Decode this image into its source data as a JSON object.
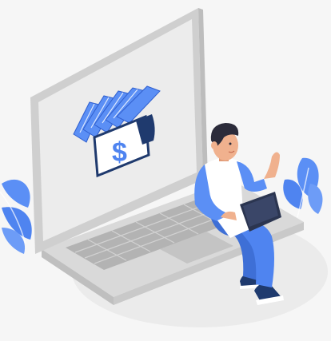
{
  "illustration": {
    "currency_symbol": "$",
    "colors": {
      "background": "#f6f6f6",
      "floor_shadow": "#ebebeb",
      "laptop_body": "#d9d9d9",
      "laptop_dark": "#bfbfbf",
      "screen": "#ececec",
      "accent_blue": "#4f84f0",
      "navy": "#1f3a6e",
      "skin": "#f0b18e",
      "hair": "#2b2b3a",
      "shirt": "#ffffff",
      "jeans": "#3e6fd6",
      "leaf": "#5b8ff5"
    }
  }
}
